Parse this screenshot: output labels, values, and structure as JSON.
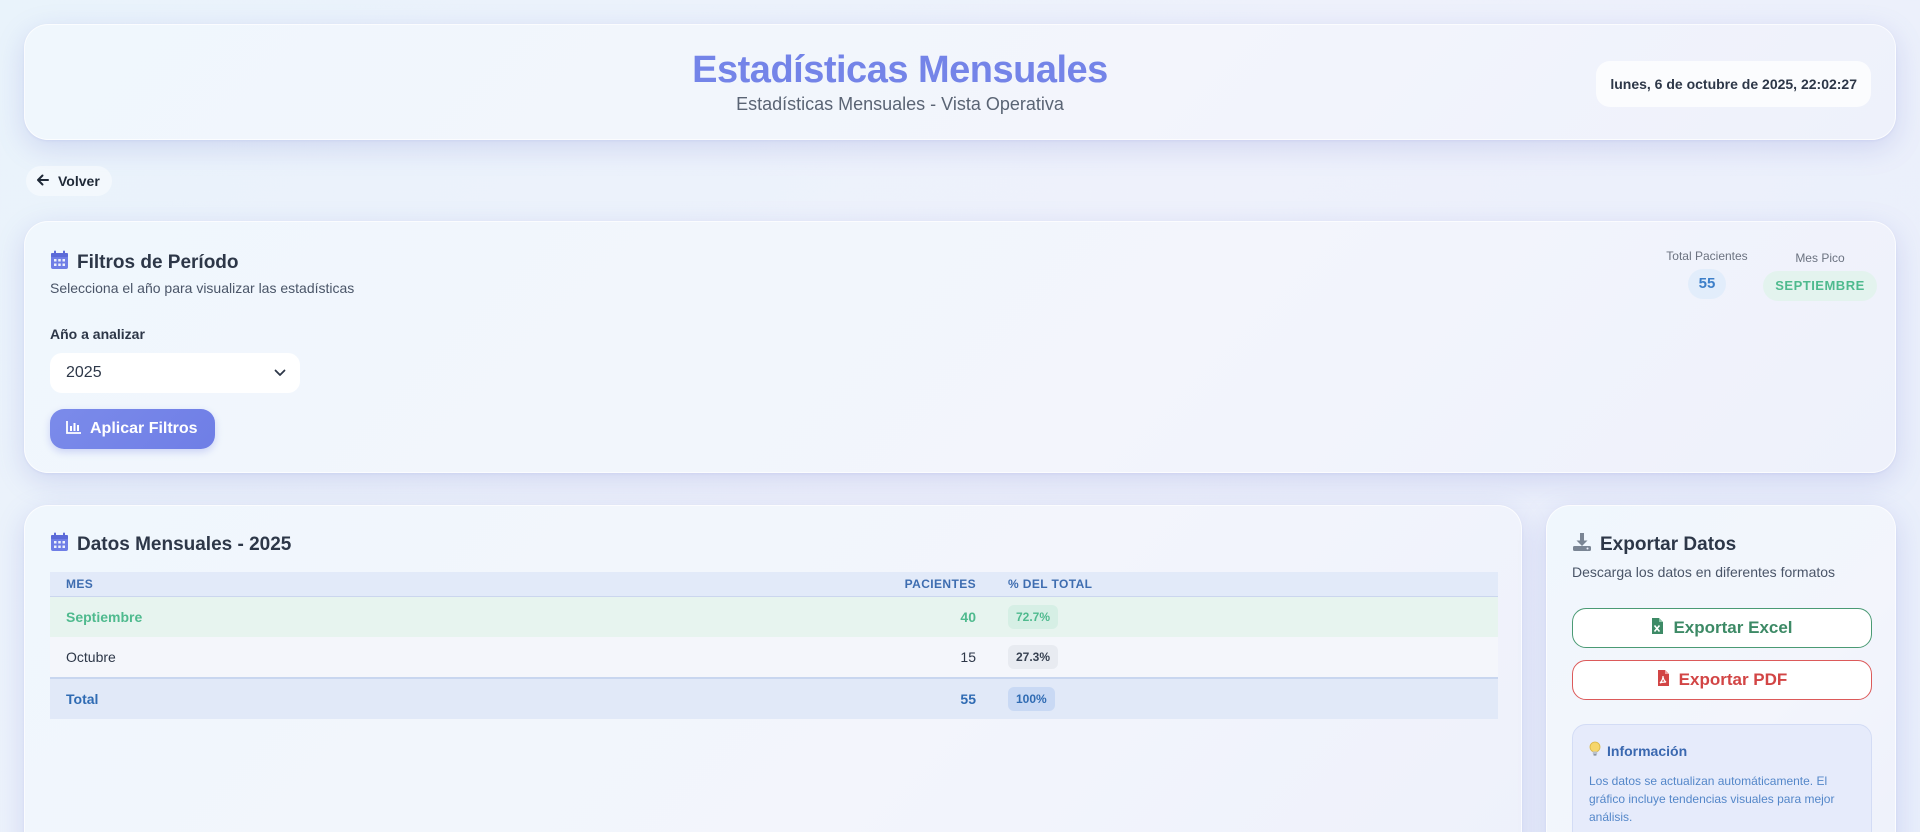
{
  "header": {
    "title": "Estadísticas Mensuales",
    "subtitle": "Estadísticas Mensuales - Vista Operativa",
    "datetime": "lunes, 6 de octubre de 2025, 22:02:27"
  },
  "nav": {
    "back_label": "Volver",
    "back_icon": "arrow-left-icon"
  },
  "filters": {
    "title": "Filtros de Período",
    "description": "Selecciona el año para visualizar las estadísticas",
    "year_label": "Año a analizar",
    "year_value": "2025",
    "apply_label": "Aplicar Filtros",
    "stats": {
      "total_label": "Total Pacientes",
      "total_value": "55",
      "peak_label": "Mes Pico",
      "peak_value": "SEPTIEMBRE"
    }
  },
  "monthly": {
    "title": "Datos Mensuales - 2025",
    "columns": [
      "MES",
      "PACIENTES",
      "% DEL TOTAL"
    ],
    "rows": [
      {
        "month": "Septiembre",
        "patients": "40",
        "percent": "72.7%"
      },
      {
        "month": "Octubre",
        "patients": "15",
        "percent": "27.3%"
      }
    ],
    "total": {
      "label": "Total",
      "patients": "55",
      "percent": "100%"
    }
  },
  "export": {
    "title": "Exportar Datos",
    "description": "Descarga los datos en diferentes formatos",
    "excel_label": "Exportar Excel",
    "pdf_label": "Exportar PDF",
    "info_title": "Información",
    "info_text": "Los datos se actualizan automáticamente. El gráfico incluye tendencias visuales para mejor análisis."
  },
  "colors": {
    "accent": "#7484e8",
    "peak": "#4fba8e",
    "total": "#2f6bb3",
    "excel": "#3d8a66",
    "pdf": "#d24545"
  }
}
